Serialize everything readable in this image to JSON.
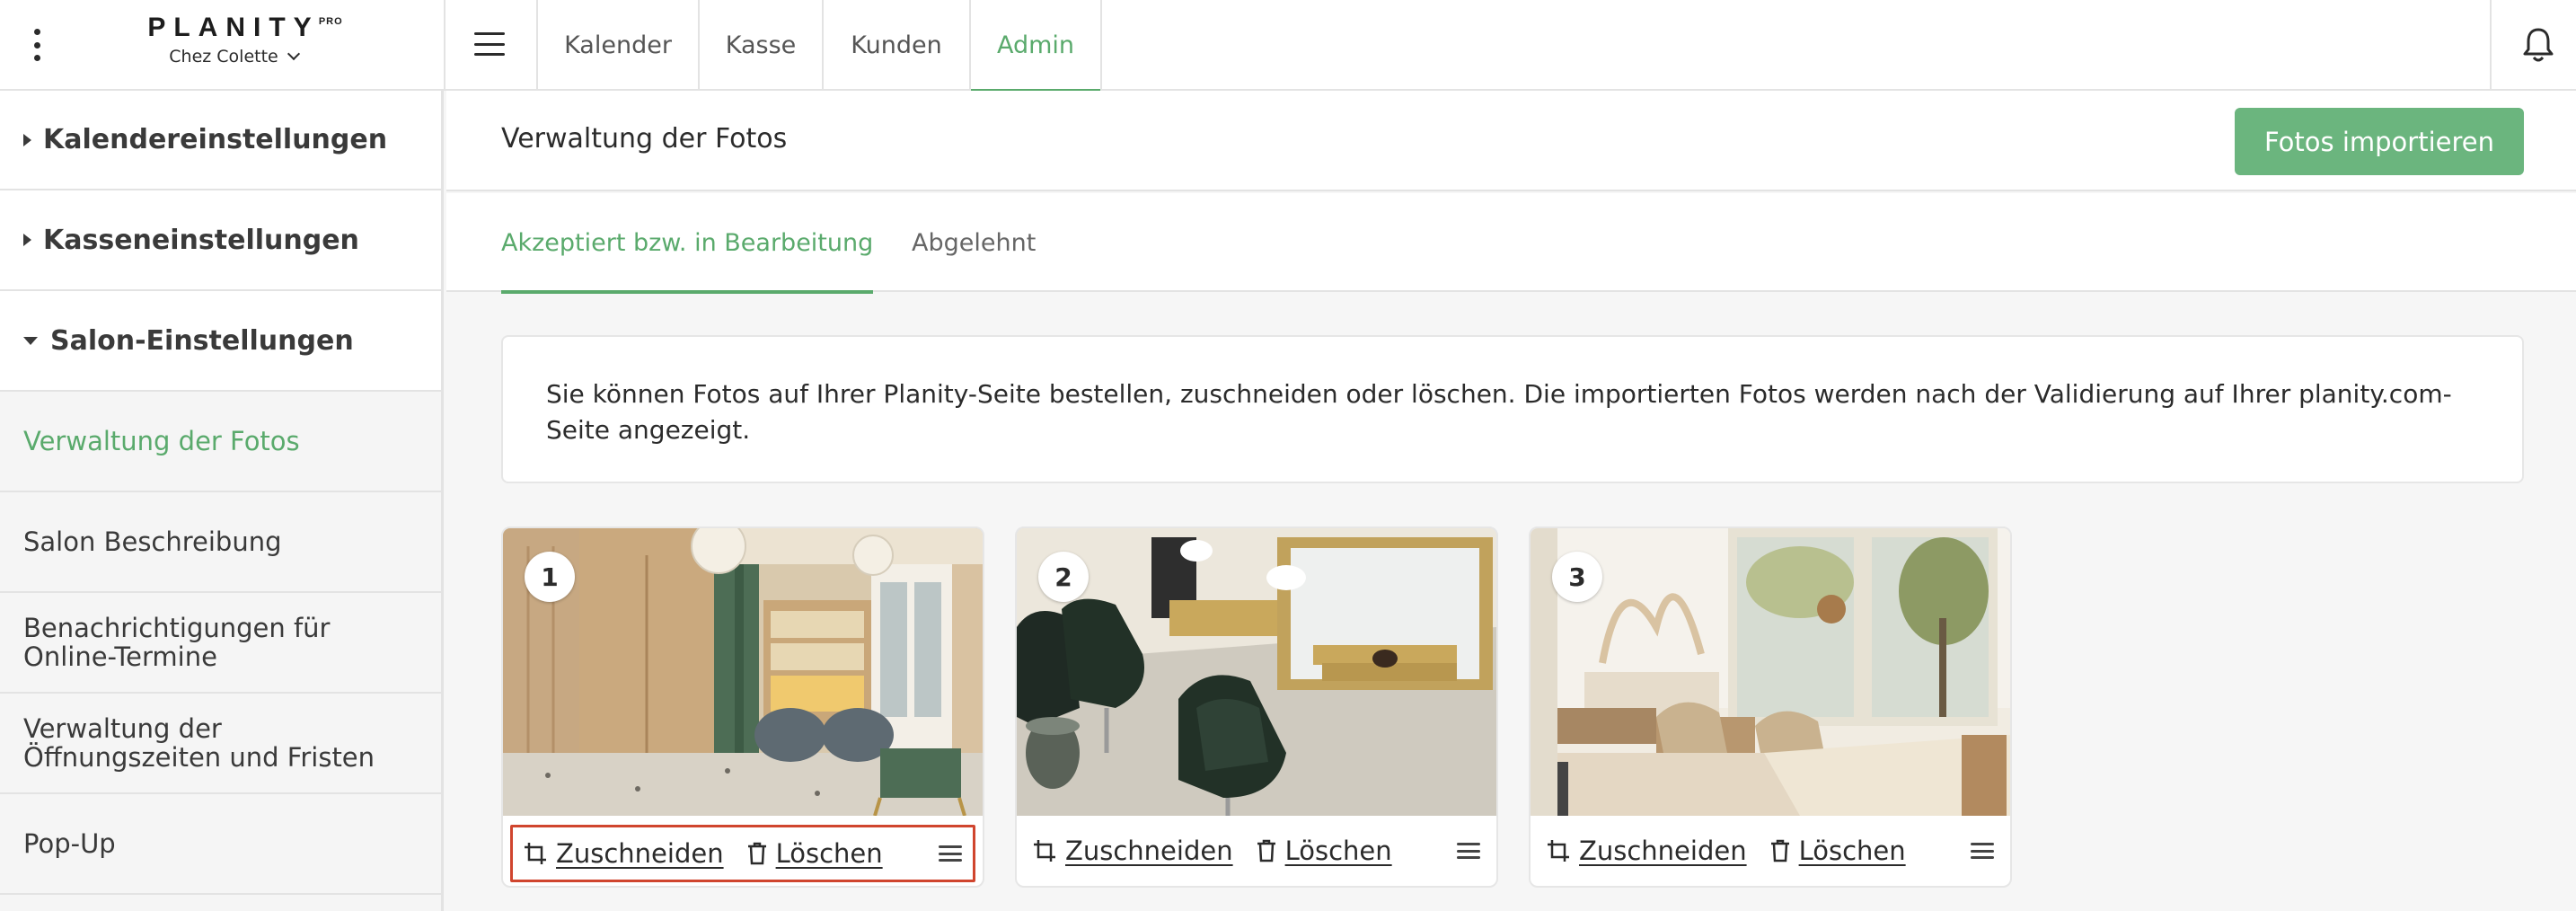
{
  "header": {
    "brand": "PLANITY",
    "brand_badge": "PRO",
    "salon_name": "Chez Colette",
    "nav_tabs": [
      {
        "label": "Kalender",
        "active": false
      },
      {
        "label": "Kasse",
        "active": false
      },
      {
        "label": "Kunden",
        "active": false
      },
      {
        "label": "Admin",
        "active": true
      }
    ]
  },
  "sidebar": {
    "sections": [
      {
        "label": "Kalendereinstellungen",
        "expanded": false
      },
      {
        "label": "Kasseneinstellungen",
        "expanded": false
      },
      {
        "label": "Salon-Einstellungen",
        "expanded": true
      }
    ],
    "items": [
      {
        "label": "Verwaltung der Fotos",
        "active": true
      },
      {
        "label": "Salon Beschreibung",
        "active": false
      },
      {
        "label": "Benachrichtigungen für Online-Termine",
        "active": false
      },
      {
        "label": "Verwaltung der Öffnungszeiten und Fristen",
        "active": false
      },
      {
        "label": "Pop-Up",
        "active": false
      }
    ]
  },
  "main": {
    "title": "Verwaltung der Fotos",
    "import_button": "Fotos importieren",
    "tabs": [
      {
        "label": "Akzeptiert bzw. in Bearbeitung",
        "active": true
      },
      {
        "label": "Abgelehnt",
        "active": false
      }
    ],
    "info_text": "Sie können Fotos auf Ihrer Planity-Seite bestellen, zuschneiden oder löschen. Die importierten Fotos werden nach der Validierung auf Ihrer planity.com-Seite angezeigt."
  },
  "photos": [
    {
      "number": "1",
      "crop_label": "Zuschneiden",
      "delete_label": "Löschen",
      "highlighted": true
    },
    {
      "number": "2",
      "crop_label": "Zuschneiden",
      "delete_label": "Löschen",
      "highlighted": false
    },
    {
      "number": "3",
      "crop_label": "Zuschneiden",
      "delete_label": "Löschen",
      "highlighted": false
    }
  ],
  "colors": {
    "accent": "#5aaa6c",
    "button": "#6bb57e",
    "highlight_border": "#d0452e"
  },
  "icons": [
    "more-vertical-icon",
    "chevron-down-icon",
    "menu-icon",
    "bell-icon",
    "caret-right-icon",
    "caret-down-icon",
    "crop-icon",
    "trash-icon",
    "drag-handle-icon"
  ]
}
